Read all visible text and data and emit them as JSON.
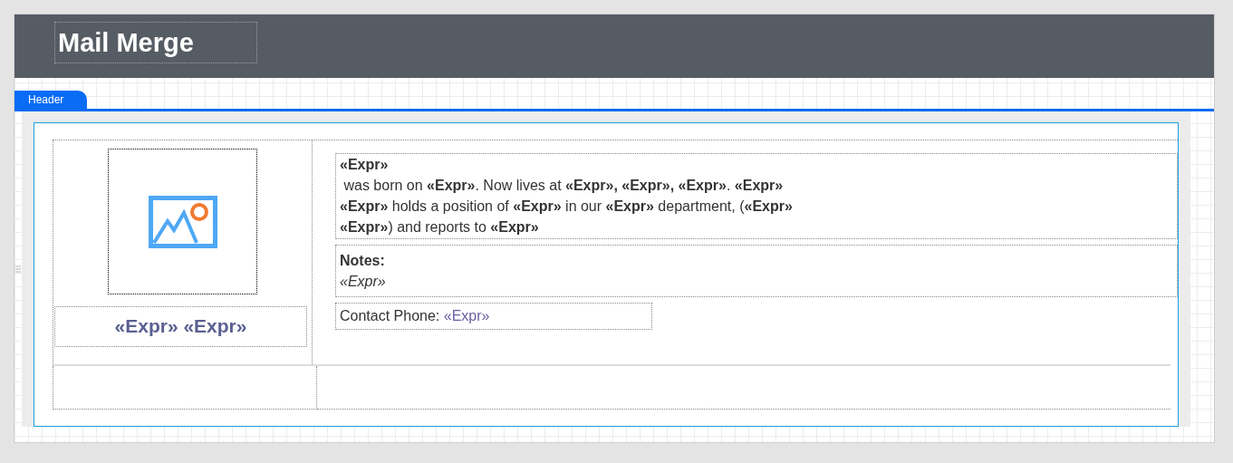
{
  "report_title": "Mail Merge",
  "band_tab": {
    "label": "Header"
  },
  "photo_caption": "«Expr» «Expr»",
  "bio_lines": [
    "**«Expr»**",
    " was born on **«Expr»**. Now lives at **«Expr», «Expr», «Expr»**. **«Expr»**",
    "**«Expr»** holds a position of **«Expr»** in our **«Expr»** department, (**«Expr»**",
    "**«Expr»**) and reports to **«Expr»**"
  ],
  "notes": {
    "label": "Notes:",
    "value": "«Expr»"
  },
  "contact": {
    "label": "Contact Phone:",
    "value": "«Expr»"
  }
}
